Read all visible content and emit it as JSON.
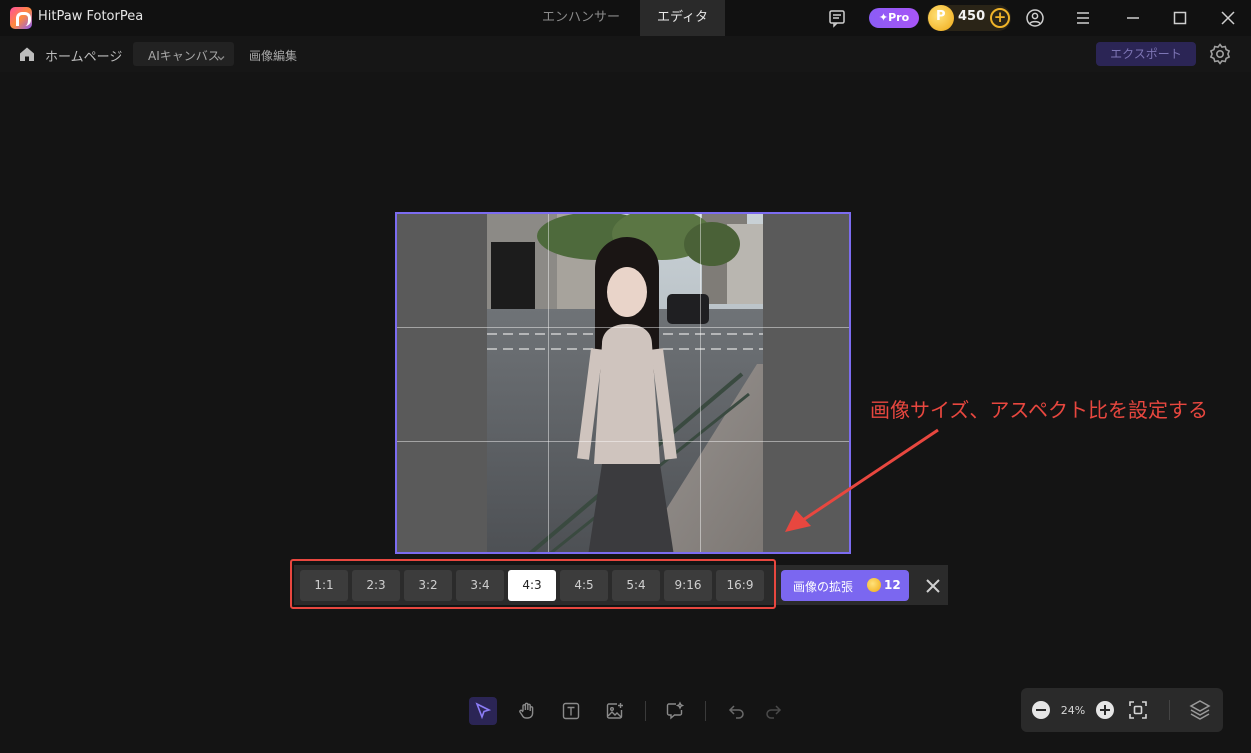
{
  "titlebar": {
    "app_name": "HitPaw FotorPea",
    "tabs": [
      {
        "label": "エンハンサー",
        "active": false
      },
      {
        "label": "エディタ",
        "active": true
      }
    ],
    "pro_label": "Pro",
    "coins": "450"
  },
  "toolbar": {
    "home_label": "ホームページ",
    "canvas_select": "AIキャンバス",
    "edit_label": "画像編集",
    "export_label": "エクスポート"
  },
  "annotation": {
    "text": "画像サイズ、アスペクト比を設定する",
    "color": "#e8473f"
  },
  "ratio_bar": {
    "options": [
      "1:1",
      "2:3",
      "3:2",
      "3:4",
      "4:3",
      "4:5",
      "5:4",
      "9:16",
      "16:9"
    ],
    "selected": "4:3",
    "expand_label": "画像の拡張",
    "expand_cost": "12"
  },
  "zoom": {
    "value": "24%"
  },
  "colors": {
    "accent": "#7b67f0",
    "background": "#141414",
    "highlight": "#e8473f"
  },
  "icons": {
    "tools": [
      "select-icon",
      "hand-icon",
      "text-icon",
      "add-image-icon",
      "ai-chat-icon",
      "undo-icon",
      "redo-icon"
    ]
  }
}
